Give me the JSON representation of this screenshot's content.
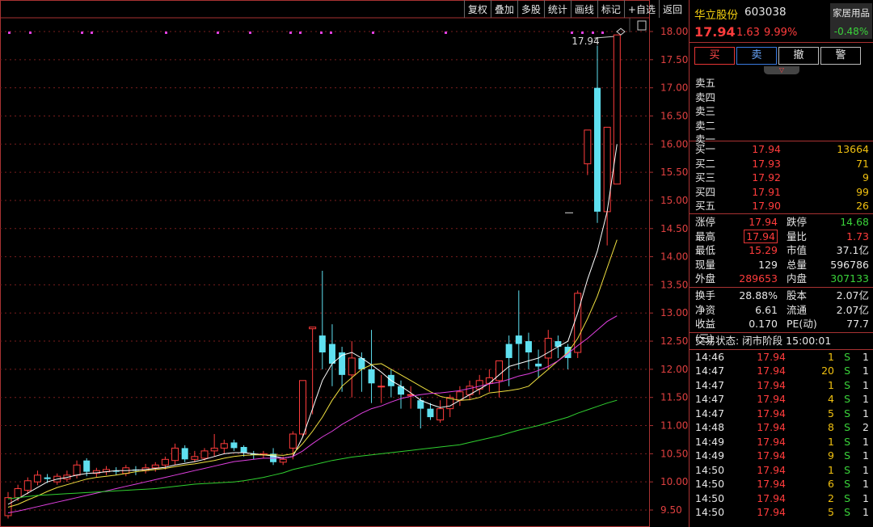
{
  "toolbar": [
    "复权",
    "叠加",
    "多股",
    "统计",
    "画线",
    "标记",
    "+自选",
    "返回"
  ],
  "chart_data": {
    "type": "candlestick",
    "y_axis_ticks": [
      "18.00",
      "17.50",
      "17.00",
      "16.50",
      "16.00",
      "15.50",
      "15.00",
      "14.50",
      "14.00",
      "13.50",
      "13.00",
      "12.50",
      "12.00",
      "11.50",
      "11.00",
      "10.50",
      "10.00",
      "9.50"
    ],
    "ylim": [
      9.3,
      18.1
    ],
    "peak_label": "17.94",
    "candles": [
      [
        9.4,
        9.72,
        9.35,
        9.82
      ],
      [
        9.72,
        9.88,
        9.66,
        9.95
      ],
      [
        9.85,
        10.02,
        9.78,
        10.08
      ],
      [
        10.0,
        10.12,
        9.94,
        10.2
      ],
      [
        10.08,
        10.05,
        9.98,
        10.14
      ],
      [
        10.0,
        10.1,
        9.95,
        10.15
      ],
      [
        10.05,
        10.12,
        10.0,
        10.2
      ],
      [
        10.12,
        10.3,
        10.06,
        10.38
      ],
      [
        10.38,
        10.18,
        10.1,
        10.42
      ],
      [
        10.15,
        10.2,
        10.08,
        10.25
      ],
      [
        10.18,
        10.22,
        10.12,
        10.28
      ],
      [
        10.2,
        10.18,
        10.12,
        10.26
      ],
      [
        10.15,
        10.25,
        10.1,
        10.3
      ],
      [
        10.22,
        10.2,
        10.12,
        10.28
      ],
      [
        10.2,
        10.25,
        10.15,
        10.32
      ],
      [
        10.25,
        10.3,
        10.18,
        10.35
      ],
      [
        10.3,
        10.4,
        10.22,
        10.45
      ],
      [
        10.38,
        10.6,
        10.3,
        10.68
      ],
      [
        10.6,
        10.4,
        10.35,
        10.65
      ],
      [
        10.4,
        10.45,
        10.35,
        10.55
      ],
      [
        10.42,
        10.55,
        10.38,
        10.6
      ],
      [
        10.55,
        10.6,
        10.45,
        10.85
      ],
      [
        10.6,
        10.68,
        10.5,
        10.75
      ],
      [
        10.7,
        10.6,
        10.55,
        10.75
      ],
      [
        10.62,
        10.52,
        10.45,
        10.65
      ],
      [
        10.5,
        10.48,
        10.4,
        10.55
      ],
      [
        10.48,
        10.5,
        10.42,
        10.55
      ],
      [
        10.5,
        10.35,
        10.3,
        10.6
      ],
      [
        10.35,
        10.4,
        10.3,
        10.45
      ],
      [
        10.6,
        10.85,
        10.4,
        10.9
      ],
      [
        10.85,
        11.8,
        10.8,
        11.8
      ],
      [
        12.72,
        12.75,
        11.2,
        12.75
      ],
      [
        12.6,
        12.3,
        12.0,
        13.75
      ],
      [
        12.45,
        12.1,
        11.7,
        12.8
      ],
      [
        12.3,
        11.9,
        11.6,
        12.4
      ],
      [
        11.9,
        12.2,
        11.5,
        12.5
      ],
      [
        12.2,
        12.0,
        11.6,
        12.3
      ],
      [
        12.0,
        11.75,
        11.4,
        12.7
      ],
      [
        11.7,
        11.7,
        11.4,
        11.9
      ],
      [
        11.9,
        11.7,
        11.5,
        12.0
      ],
      [
        11.7,
        11.55,
        11.3,
        11.8
      ],
      [
        11.55,
        11.55,
        11.3,
        11.7
      ],
      [
        11.45,
        11.3,
        10.95,
        11.5
      ],
      [
        11.3,
        11.15,
        11.1,
        11.4
      ],
      [
        11.1,
        11.3,
        11.05,
        11.45
      ],
      [
        11.3,
        11.5,
        11.15,
        11.55
      ],
      [
        11.45,
        11.6,
        11.35,
        11.7
      ],
      [
        11.55,
        11.7,
        11.45,
        11.8
      ],
      [
        11.65,
        11.8,
        11.55,
        11.9
      ],
      [
        11.75,
        11.85,
        11.6,
        12.0
      ],
      [
        11.8,
        12.15,
        11.5,
        12.15
      ],
      [
        12.45,
        12.2,
        11.7,
        12.6
      ],
      [
        12.6,
        12.45,
        12.0,
        13.4
      ],
      [
        12.5,
        12.3,
        12.0,
        12.65
      ],
      [
        12.1,
        12.05,
        11.85,
        12.35
      ],
      [
        12.2,
        12.55,
        12.0,
        12.7
      ],
      [
        12.5,
        12.4,
        12.2,
        12.6
      ],
      [
        12.4,
        12.2,
        12.0,
        12.45
      ],
      [
        12.3,
        13.35,
        12.2,
        13.4
      ],
      [
        15.65,
        16.25,
        15.45,
        16.25
      ],
      [
        17.0,
        14.8,
        14.6,
        17.75
      ],
      [
        14.8,
        16.3,
        14.2,
        16.3
      ],
      [
        15.29,
        17.94,
        15.29,
        17.94
      ]
    ],
    "ma_lines": [
      {
        "color": "#ffffff",
        "values": [
          9.6,
          9.7,
          9.8,
          9.9,
          10.0,
          10.05,
          10.08,
          10.12,
          10.15,
          10.16,
          10.18,
          10.2,
          10.2,
          10.21,
          10.22,
          10.24,
          10.26,
          10.3,
          10.33,
          10.36,
          10.4,
          10.45,
          10.5,
          10.52,
          10.52,
          10.5,
          10.48,
          10.46,
          10.42,
          10.45,
          10.8,
          11.3,
          11.8,
          12.1,
          12.25,
          12.3,
          12.2,
          12.08,
          11.95,
          11.8,
          11.7,
          11.58,
          11.45,
          11.38,
          11.32,
          11.35,
          11.45,
          11.55,
          11.65,
          11.75,
          11.9,
          12.05,
          12.1,
          12.15,
          12.2,
          12.3,
          12.4,
          12.5,
          13.0,
          13.6,
          14.1,
          14.8,
          16.0
        ]
      },
      {
        "color": "#f0e040",
        "values": [
          9.55,
          9.6,
          9.68,
          9.75,
          9.83,
          9.9,
          9.95,
          10.0,
          10.05,
          10.08,
          10.1,
          10.12,
          10.15,
          10.18,
          10.2,
          10.22,
          10.24,
          10.27,
          10.3,
          10.32,
          10.35,
          10.38,
          10.42,
          10.45,
          10.47,
          10.48,
          10.48,
          10.48,
          10.47,
          10.5,
          10.68,
          10.9,
          11.15,
          11.45,
          11.7,
          11.85,
          12.0,
          12.08,
          12.1,
          12.0,
          11.9,
          11.8,
          11.7,
          11.6,
          11.52,
          11.48,
          11.45,
          11.46,
          11.5,
          11.58,
          11.6,
          11.62,
          11.65,
          11.7,
          11.85,
          12.0,
          12.15,
          12.3,
          12.55,
          12.9,
          13.3,
          13.8,
          14.3
        ]
      },
      {
        "color": "#e040e0",
        "values": [
          9.45,
          9.48,
          9.52,
          9.56,
          9.6,
          9.64,
          9.68,
          9.72,
          9.76,
          9.8,
          9.84,
          9.88,
          9.92,
          9.96,
          10.0,
          10.04,
          10.08,
          10.12,
          10.16,
          10.2,
          10.24,
          10.28,
          10.32,
          10.36,
          10.38,
          10.4,
          10.42,
          10.42,
          10.42,
          10.45,
          10.55,
          10.68,
          10.8,
          10.9,
          11.02,
          11.12,
          11.22,
          11.3,
          11.35,
          11.42,
          11.48,
          11.52,
          11.55,
          11.57,
          11.58,
          11.6,
          11.62,
          11.66,
          11.7,
          11.74,
          11.77,
          11.82,
          11.88,
          11.92,
          11.98,
          12.05,
          12.15,
          12.28,
          12.42,
          12.55,
          12.7,
          12.85,
          12.95
        ]
      },
      {
        "color": "#30d030",
        "values": [
          9.7,
          9.72,
          9.74,
          9.76,
          9.77,
          9.78,
          9.79,
          9.8,
          9.81,
          9.82,
          9.83,
          9.84,
          9.85,
          9.86,
          9.87,
          9.88,
          9.9,
          9.92,
          9.94,
          9.96,
          9.97,
          9.98,
          9.99,
          10.0,
          10.02,
          10.05,
          10.08,
          10.12,
          10.16,
          10.22,
          10.26,
          10.3,
          10.34,
          10.38,
          10.41,
          10.44,
          10.46,
          10.48,
          10.5,
          10.52,
          10.54,
          10.56,
          10.58,
          10.6,
          10.62,
          10.64,
          10.66,
          10.7,
          10.74,
          10.78,
          10.82,
          10.87,
          10.92,
          10.96,
          11.0,
          11.05,
          11.1,
          11.15,
          11.22,
          11.28,
          11.34,
          11.4,
          11.45
        ]
      }
    ]
  },
  "stock": {
    "name": "华立股份",
    "code": "603038",
    "price": "17.94",
    "change": "1.63",
    "pct": "9.99%"
  },
  "sector": {
    "name": "家居用品",
    "pct": "-0.48%"
  },
  "actions": {
    "buy": "买",
    "sell": "卖",
    "cancel": "撤",
    "alert": "警"
  },
  "sell_levels": [
    "卖五",
    "卖四",
    "卖三",
    "卖二",
    "卖一"
  ],
  "buy_levels": [
    {
      "label": "买一",
      "price": "17.94",
      "vol": "13664"
    },
    {
      "label": "买二",
      "price": "17.93",
      "vol": "71"
    },
    {
      "label": "买三",
      "price": "17.92",
      "vol": "9"
    },
    {
      "label": "买四",
      "price": "17.91",
      "vol": "99"
    },
    {
      "label": "买五",
      "price": "17.90",
      "vol": "26"
    }
  ],
  "quote": {
    "limit_up_label": "涨停",
    "limit_up": "17.94",
    "limit_down_label": "跌停",
    "limit_down": "14.68",
    "high_label": "最高",
    "high": "17.94",
    "vol_ratio_label": "量比",
    "vol_ratio": "1.73",
    "low_label": "最低",
    "low": "15.29",
    "mkt_cap_label": "市值",
    "mkt_cap": "37.1亿",
    "cur_vol_label": "现量",
    "cur_vol": "129",
    "total_vol_label": "总量",
    "total_vol": "596786",
    "outer_label": "外盘",
    "outer": "289653",
    "inner_label": "内盘",
    "inner": "307133"
  },
  "fund": {
    "turnover_label": "换手",
    "turnover": "28.88%",
    "shares_label": "股本",
    "shares": "2.07亿",
    "nav_label": "净资",
    "nav": "6.61",
    "float_label": "流通",
    "float": "2.07亿",
    "eps_label": "收益(三)",
    "eps": "0.170",
    "pe_label": "PE(动)",
    "pe": "77.7"
  },
  "status": "交易状态: 闭市阶段 15:00:01",
  "trades": [
    {
      "t": "14:46",
      "p": "17.94",
      "v": "1",
      "bs": "S",
      "n": "1"
    },
    {
      "t": "14:47",
      "p": "17.94",
      "v": "20",
      "bs": "S",
      "n": "1"
    },
    {
      "t": "14:47",
      "p": "17.94",
      "v": "1",
      "bs": "S",
      "n": "1"
    },
    {
      "t": "14:47",
      "p": "17.94",
      "v": "4",
      "bs": "S",
      "n": "1"
    },
    {
      "t": "14:47",
      "p": "17.94",
      "v": "5",
      "bs": "S",
      "n": "1"
    },
    {
      "t": "14:48",
      "p": "17.94",
      "v": "8",
      "bs": "S",
      "n": "2"
    },
    {
      "t": "14:49",
      "p": "17.94",
      "v": "1",
      "bs": "S",
      "n": "1"
    },
    {
      "t": "14:49",
      "p": "17.94",
      "v": "9",
      "bs": "S",
      "n": "1"
    },
    {
      "t": "14:50",
      "p": "17.94",
      "v": "1",
      "bs": "S",
      "n": "1"
    },
    {
      "t": "14:50",
      "p": "17.94",
      "v": "6",
      "bs": "S",
      "n": "1"
    },
    {
      "t": "14:50",
      "p": "17.94",
      "v": "2",
      "bs": "S",
      "n": "1"
    },
    {
      "t": "14:50",
      "p": "17.94",
      "v": "5",
      "bs": "S",
      "n": "1"
    }
  ]
}
